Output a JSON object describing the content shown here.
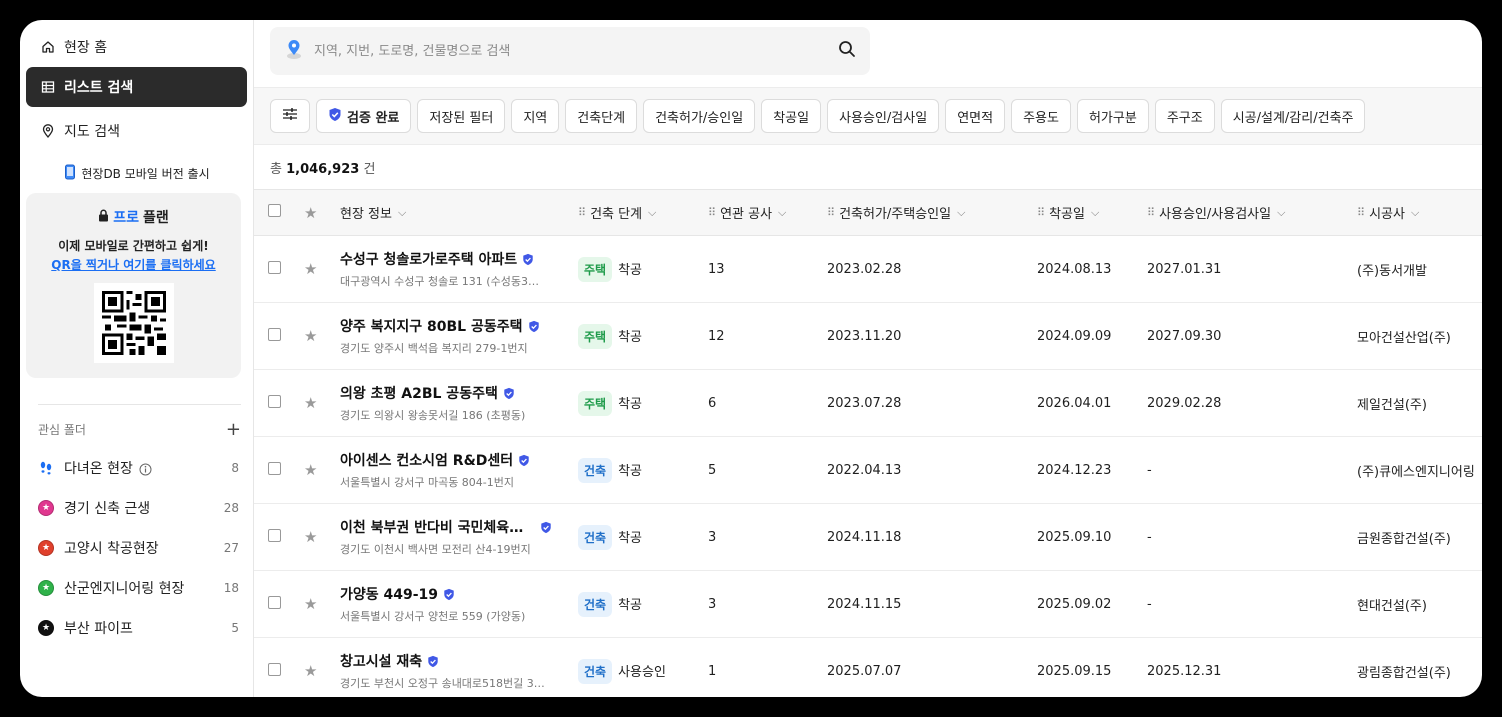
{
  "sidebar": {
    "nav": [
      {
        "label": "현장 홈",
        "icon": "home-icon"
      },
      {
        "label": "리스트 검색",
        "icon": "table-icon"
      },
      {
        "label": "지도 검색",
        "icon": "map-pin-icon"
      }
    ],
    "mobile_release": "현장DB 모바일 버전 출시",
    "promo": {
      "pro": "프로",
      "plan": "플랜",
      "text": "이제 모바일로 간편하고 쉽게!",
      "link": "QR을 찍거나 여기를 클릭하세요"
    },
    "folders_title": "관심 폴더",
    "add_symbol": "+",
    "folders": [
      {
        "label": "다녀온 현장",
        "count": "8",
        "color": "#1b6ef3"
      },
      {
        "label": "경기 신축 근생",
        "count": "28",
        "color": "#e0378f"
      },
      {
        "label": "고양시 착공현장",
        "count": "27",
        "color": "#e0402c"
      },
      {
        "label": "산군엔지니어링 현장",
        "count": "18",
        "color": "#2fb24a"
      },
      {
        "label": "부산 파이프",
        "count": "5",
        "color": "#111111"
      }
    ]
  },
  "search": {
    "placeholder": "지역, 지번, 도로명, 건물명으로 검색"
  },
  "filters": [
    "검증 완료",
    "저장된 필터",
    "지역",
    "건축단계",
    "건축허가/승인일",
    "착공일",
    "사용승인/검사일",
    "연면적",
    "주용도",
    "허가구분",
    "주구조",
    "시공/설계/감리/건축주"
  ],
  "total": {
    "prefix": "총",
    "count": "1,046,923",
    "suffix": "건"
  },
  "columns": [
    "현장 정보",
    "건축 단계",
    "연관 공사",
    "건축허가/주택승인일",
    "착공일",
    "사용승인/사용검사일",
    "시공사"
  ],
  "rows": [
    {
      "name": "수성구 청솔로가로주택 아파트",
      "addr": "대구광역시 수성구 청솔로 131 (수성동3…",
      "type": "주택",
      "stage": "착공",
      "related": "13",
      "permit": "2023.02.28",
      "start": "2024.08.13",
      "approval": "2027.01.31",
      "builder": "(주)동서개발"
    },
    {
      "name": "양주 복지지구 80BL 공동주택",
      "addr": "경기도 양주시 백석읍 복지리 279-1번지",
      "type": "주택",
      "stage": "착공",
      "related": "12",
      "permit": "2023.11.20",
      "start": "2024.09.09",
      "approval": "2027.09.30",
      "builder": "모아건설산업(주)"
    },
    {
      "name": "의왕 초평 A2BL 공동주택",
      "addr": "경기도 의왕시 왕송못서길 186 (초평동)",
      "type": "주택",
      "stage": "착공",
      "related": "6",
      "permit": "2023.07.28",
      "start": "2026.04.01",
      "approval": "2029.02.28",
      "builder": "제일건설(주)"
    },
    {
      "name": "아이센스 컨소시엄 R&D센터",
      "addr": "서울특별시 강서구 마곡동 804-1번지",
      "type": "건축",
      "stage": "착공",
      "related": "5",
      "permit": "2022.04.13",
      "start": "2024.12.23",
      "approval": "-",
      "builder": "(주)큐에스엔지니어링"
    },
    {
      "name": "이천 북부권 반다비 국민체육센…",
      "addr": "경기도 이천시 백사면 모전리 산4-19번지",
      "type": "건축",
      "stage": "착공",
      "related": "3",
      "permit": "2024.11.18",
      "start": "2025.09.10",
      "approval": "-",
      "builder": "금원종합건설(주)"
    },
    {
      "name": "가양동 449-19",
      "addr": "서울특별시 강서구 양천로 559 (가양동)",
      "type": "건축",
      "stage": "착공",
      "related": "3",
      "permit": "2024.11.15",
      "start": "2025.09.02",
      "approval": "-",
      "builder": "현대건설(주)"
    },
    {
      "name": "창고시설 재축",
      "addr": "경기도 부천시 오정구 송내대로518번길 3…",
      "type": "건축",
      "stage": "사용승인",
      "related": "1",
      "permit": "2025.07.07",
      "start": "2025.09.15",
      "approval": "2025.12.31",
      "builder": "광림종합건설(주)"
    }
  ]
}
